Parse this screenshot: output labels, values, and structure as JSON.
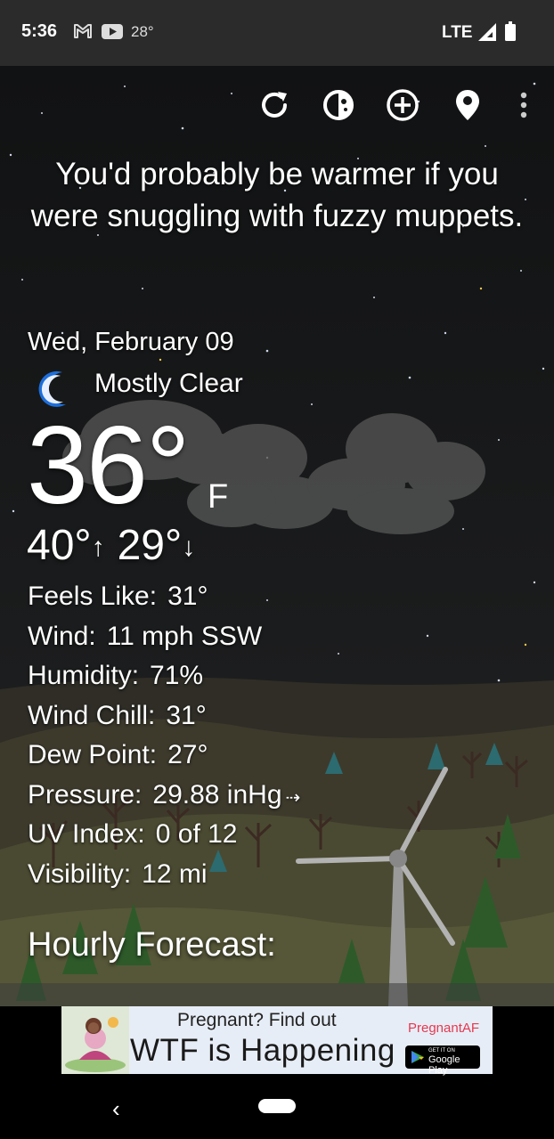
{
  "status_bar": {
    "time": "5:36",
    "temperature": "28°",
    "network": "LTE",
    "icons": [
      "gmail-icon",
      "youtube-icon",
      "signal-icon",
      "battery-icon"
    ]
  },
  "toolbar": {
    "icons": [
      "refresh-icon",
      "theme-icon",
      "add-location-icon",
      "location-pin-icon",
      "more-vert-icon"
    ]
  },
  "quote": "You'd probably be warmer if you were snuggling with fuzzy muppets.",
  "current": {
    "date": "Wed, February 09",
    "condition": "Mostly Clear",
    "condition_icon": "moon-icon",
    "temperature": "36°",
    "unit": "F",
    "high": "40°",
    "low": "29°",
    "high_arrow": "↑",
    "low_arrow": "↓"
  },
  "details": {
    "feels_like": {
      "label": "Feels Like:",
      "value": "31°"
    },
    "wind": {
      "label": "Wind:",
      "value": "11 mph SSW"
    },
    "humidity": {
      "label": "Humidity:",
      "value": "71%"
    },
    "wind_chill": {
      "label": "Wind Chill:",
      "value": "31°"
    },
    "dew_point": {
      "label": "Dew Point:",
      "value": "27°"
    },
    "pressure": {
      "label": "Pressure:",
      "value": "29.88 inHg",
      "trend": "⇢"
    },
    "uv_index": {
      "label": "UV Index:",
      "value": "0 of 12"
    },
    "visibility": {
      "label": "Visibility:",
      "value": "12 mi"
    }
  },
  "hourly": {
    "title": "Hourly Forecast:"
  },
  "ad": {
    "small_text": "Pregnant? Find out",
    "big_text": "WTF is Happening",
    "brand": "PregnantAF",
    "store_top": "GET IT ON",
    "store_name": "Google Play"
  },
  "colors": {
    "status_bar_bg": "#2b2b2b",
    "sky": "#141516",
    "moon": "#1e6fd9",
    "ad_bg": "#e7edf6",
    "ad_brand": "#e53950"
  }
}
